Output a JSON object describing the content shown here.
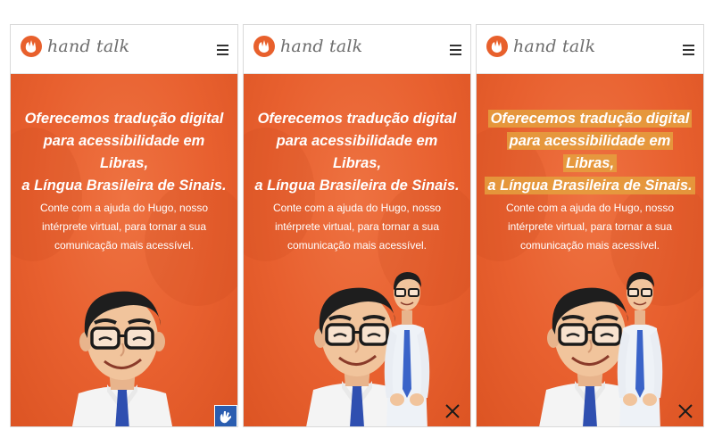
{
  "brand": {
    "name": "hand talk",
    "accent": "#e8602c"
  },
  "panels": [
    {
      "headline": [
        "Oferecemos tradução digital",
        "para acessibilidade em Libras,",
        "a Língua Brasileira de Sinais."
      ],
      "subtext": [
        "Conte com a ajuda do Hugo, nosso",
        "intérprete virtual, para tornar a sua",
        "comunicação mais acessível."
      ],
      "corner_button_icon": "sign-language-icon",
      "corner_button_color": "#2a5db0"
    },
    {
      "headline": [
        "Oferecemos tradução digital",
        "para acessibilidade em Libras,",
        "a Língua Brasileira de Sinais."
      ],
      "subtext": [
        "Conte com a ajuda do Hugo, nosso",
        "intérprete virtual, para tornar a sua",
        "comunicação mais acessível."
      ],
      "corner_button_icon": "close-icon"
    },
    {
      "headline": [
        "Oferecemos tradução digital",
        "para acessibilidade em Libras,",
        "a Língua Brasileira de Sinais."
      ],
      "subtext": [
        "Conte com a ajuda do Hugo, nosso",
        "intérprete virtual, para tornar a sua",
        "comunicação mais acessível."
      ],
      "headline_highlight_color": "#e5a03e",
      "corner_button_icon": "close-icon"
    }
  ]
}
